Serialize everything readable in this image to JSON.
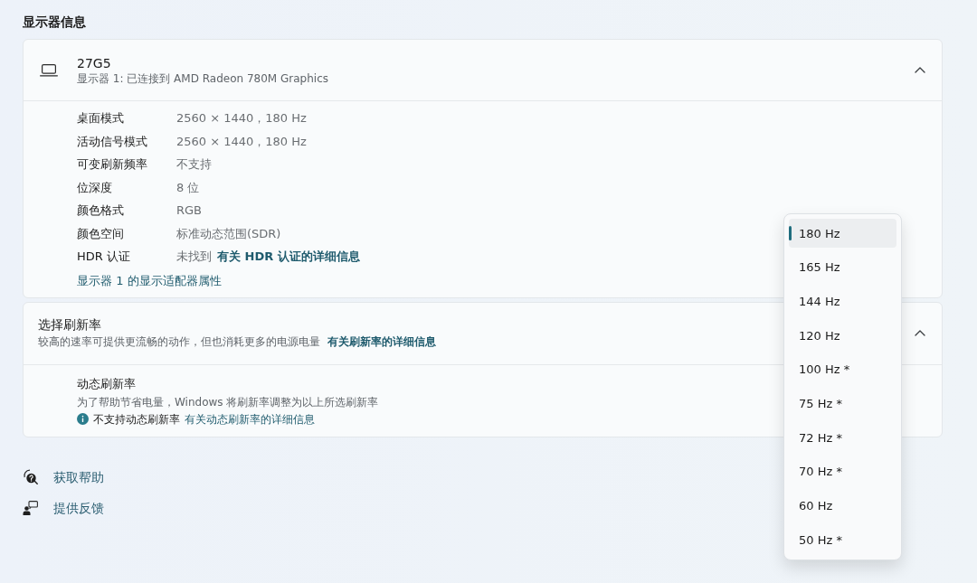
{
  "section_title": "显示器信息",
  "display_card": {
    "name": "27G5",
    "subtitle": "显示器 1: 已连接到 AMD Radeon 780M Graphics",
    "expanded": true,
    "properties": [
      {
        "label": "桌面模式",
        "value": "2560 × 1440，180 Hz"
      },
      {
        "label": "活动信号模式",
        "value": "2560 × 1440，180 Hz"
      },
      {
        "label": "可变刷新频率",
        "value": "不支持"
      },
      {
        "label": "位深度",
        "value": "8 位"
      },
      {
        "label": "颜色格式",
        "value": "RGB"
      },
      {
        "label": "颜色空间",
        "value": "标准动态范围(SDR)"
      },
      {
        "label": "HDR 认证",
        "value": "未找到",
        "link": "有关 HDR 认证的详细信息"
      }
    ],
    "adapter_link": "显示器 1 的显示适配器属性"
  },
  "refresh_card": {
    "title": "选择刷新率",
    "description": "较高的速率可提供更流畅的动作，但也消耗更多的电源电量",
    "link": "有关刷新率的详细信息",
    "expanded": true,
    "dynamic_refresh": {
      "title": "动态刷新率",
      "description": "为了帮助节省电量，Windows 将刷新率调整为以上所选刷新率",
      "notice": "不支持动态刷新率",
      "notice_link": "有关动态刷新率的详细信息"
    }
  },
  "refresh_menu": {
    "options": [
      {
        "label": "180 Hz",
        "selected": true
      },
      {
        "label": "165 Hz",
        "selected": false
      },
      {
        "label": "144 Hz",
        "selected": false
      },
      {
        "label": "120 Hz",
        "selected": false
      },
      {
        "label": "100 Hz *",
        "selected": false
      },
      {
        "label": "75 Hz *",
        "selected": false
      },
      {
        "label": "72 Hz *",
        "selected": false
      },
      {
        "label": "70 Hz *",
        "selected": false
      },
      {
        "label": "60 Hz",
        "selected": false
      },
      {
        "label": "50 Hz *",
        "selected": false
      }
    ]
  },
  "help_links": [
    {
      "label": "获取帮助",
      "kind": "help"
    },
    {
      "label": "提供反馈",
      "kind": "feedback"
    }
  ]
}
